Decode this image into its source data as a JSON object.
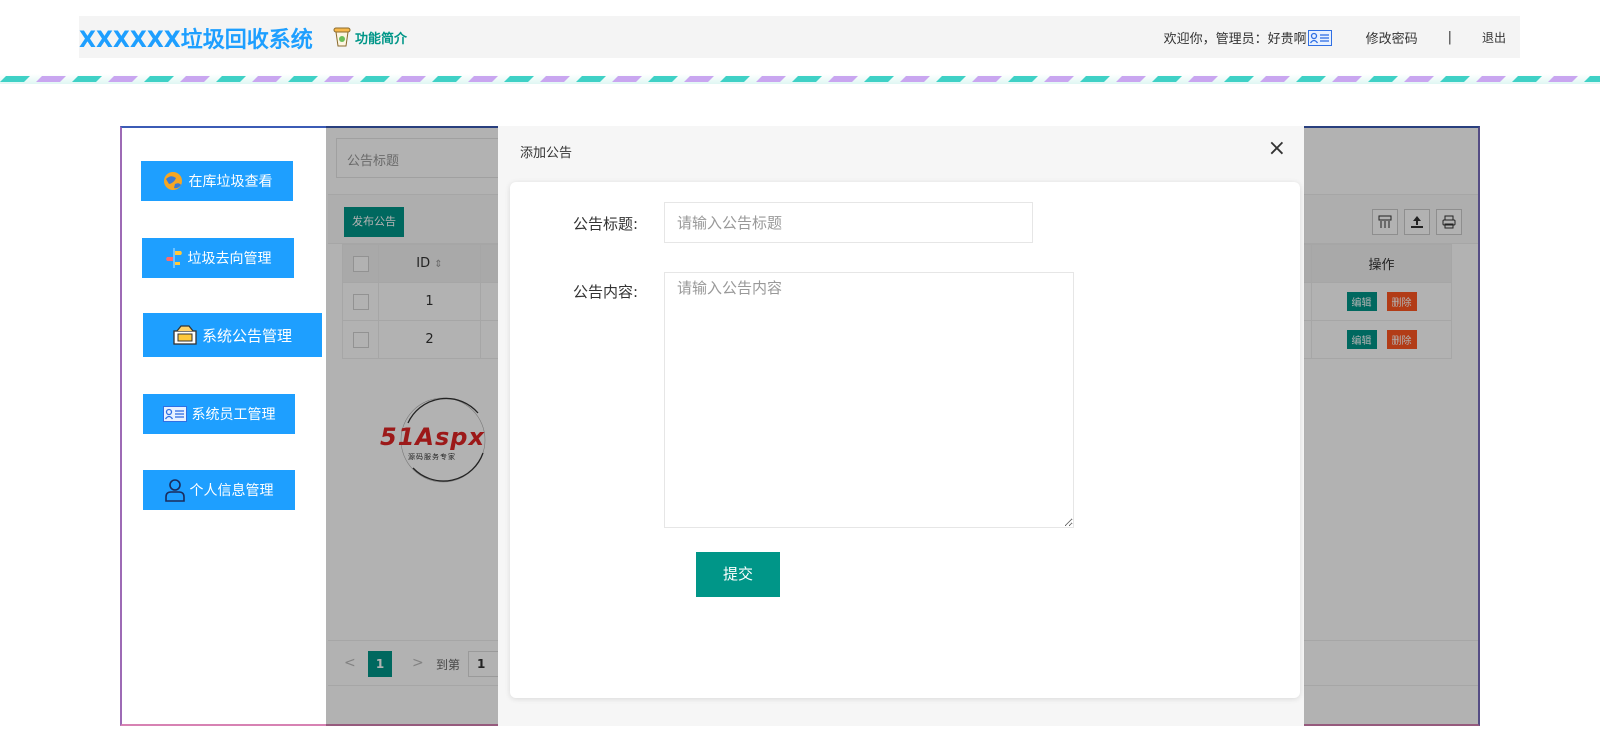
{
  "header": {
    "app_title": "XXXXXX垃圾回收系统",
    "intro_label": "功能简介",
    "welcome_text": "欢迎你，管理员：好贵啊",
    "change_password_label": "修改密码",
    "separator": "|",
    "logout_label": "退出"
  },
  "sidebar": {
    "items": [
      {
        "label": "在库垃圾查看",
        "icon": "globe-icon"
      },
      {
        "label": "垃圾去向管理",
        "icon": "signpost-icon"
      },
      {
        "label": "系统公告管理",
        "icon": "announcement-icon"
      },
      {
        "label": "系统员工管理",
        "icon": "id-card-icon"
      },
      {
        "label": "个人信息管理",
        "icon": "user-icon"
      }
    ]
  },
  "list": {
    "search_placeholder": "公告标题",
    "publish_label": "发布公告",
    "columns": {
      "id": "ID",
      "ops": "操作"
    },
    "rows": [
      {
        "id": "1",
        "edit": "编辑",
        "delete": "删除"
      },
      {
        "id": "2",
        "edit": "编辑",
        "delete": "删除"
      }
    ],
    "pager": {
      "prev": "<",
      "current": "1",
      "next": ">",
      "goto": "到第",
      "page_value": "1"
    }
  },
  "modal": {
    "title": "添加公告",
    "close": "×",
    "title_label": "公告标题:",
    "title_placeholder": "请输入公告标题",
    "content_label": "公告内容:",
    "content_placeholder": "请输入公告内容",
    "submit_label": "提交"
  },
  "watermark": {
    "brand": "51Aspx",
    "tagline": "源码服务专家"
  },
  "colors": {
    "primary": "#1e9fff",
    "accent": "#009688",
    "danger": "#ff5722"
  }
}
